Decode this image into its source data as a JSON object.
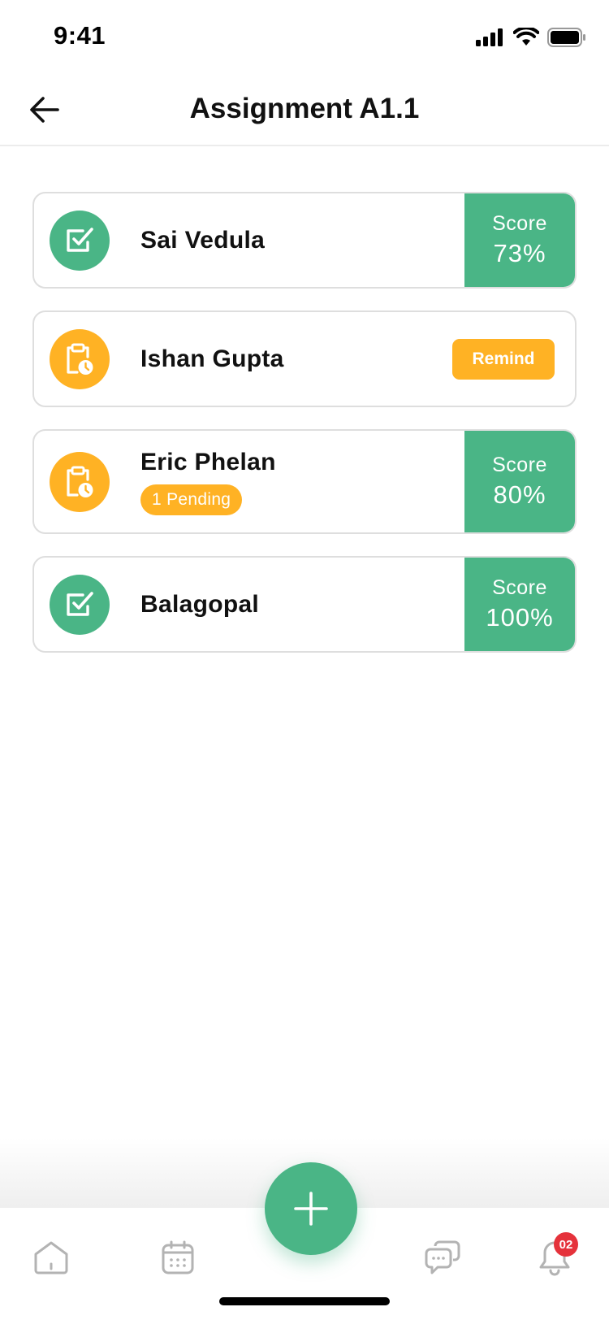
{
  "status_bar": {
    "time": "9:41"
  },
  "header": {
    "title": "Assignment A1.1"
  },
  "students": [
    {
      "name": "Sai Vedula",
      "state": "submitted",
      "score_label": "Score",
      "score": "73%"
    },
    {
      "name": "Ishan Gupta",
      "state": "not-submitted",
      "action_label": "Remind"
    },
    {
      "name": "Eric Phelan",
      "state": "partial",
      "pending_label": "1 Pending",
      "score_label": "Score",
      "score": "80%"
    },
    {
      "name": "Balagopal",
      "state": "submitted",
      "score_label": "Score",
      "score": "100%"
    }
  ],
  "bottom_nav": {
    "items": [
      "home-icon",
      "calendar-icon",
      "chat-icon",
      "bell-icon"
    ],
    "fab_icon": "plus-icon",
    "notification_count": "02"
  },
  "colors": {
    "success": "#4ab586",
    "warning": "#ffb224",
    "badge": "#e5323b"
  }
}
